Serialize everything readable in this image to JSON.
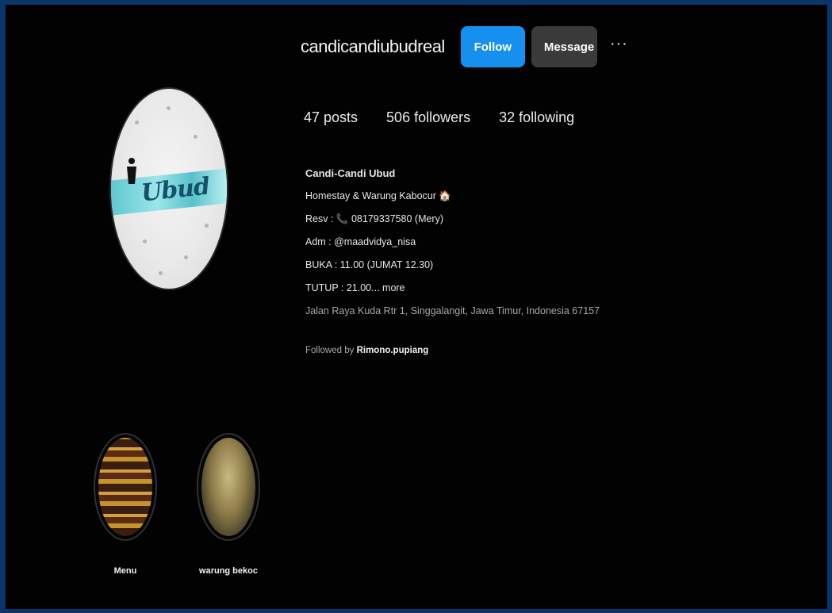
{
  "profile": {
    "username": "candicandiubudreal",
    "follow_label": "Follow",
    "message_label": "Message",
    "more_label": "···",
    "stats": {
      "posts": "47 posts",
      "followers": "506 followers",
      "following": "32 following"
    },
    "bio": {
      "name": "Candi-Candi Ubud",
      "line1": "Homestay & Warung Kabocur 🏠",
      "line2_prefix": "Resv : ",
      "line2_phone": "📞",
      "line2_rest": " 08179337580 (Mery)",
      "line3": "Adm : @maadvidya_nisa",
      "line4": "BUKA : 11.00 (JUMAT 12.30)",
      "line5": "TUTUP : 21.00... more",
      "address": "Jalan Raya Kuda Rtr 1, Singgalangit, Jawa Timur, Indonesia 67157"
    },
    "followed_by_prefix": "Followed by ",
    "followed_by_name": "Rimono.pupiang",
    "avatar_script_text": "Ubud"
  },
  "highlights": [
    {
      "label": "Menu",
      "icon": "menu-highlight-thumbnail"
    },
    {
      "label": "warung bekoc",
      "icon": "warung-highlight-thumbnail"
    }
  ],
  "colors": {
    "page_border": "#0b3468",
    "background": "#020202",
    "follow_button": "#1690ee",
    "message_button": "#3a3a3a",
    "phone_icon": "#e0314a"
  }
}
